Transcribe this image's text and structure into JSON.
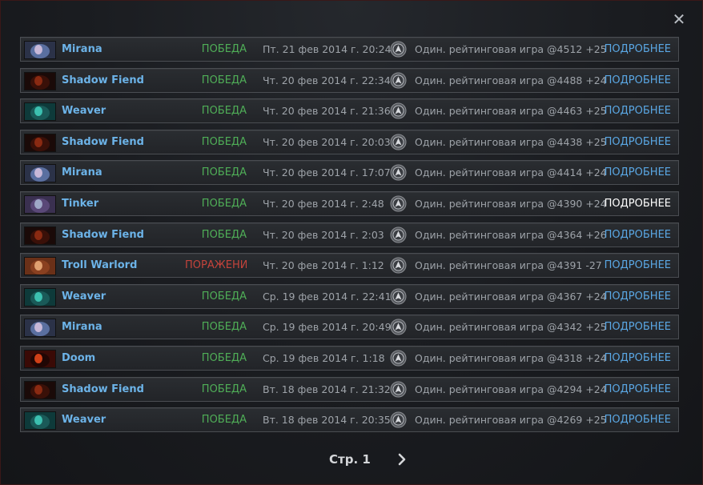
{
  "window": {
    "close_glyph": "✕"
  },
  "matches": [
    {
      "hero": "Mirana",
      "portrait": "mirana",
      "result": "ПОБЕДА",
      "outcome": "win",
      "date": "Пт. 21 фев 2014 г. 20:24",
      "mode": "Один. рейтинговая игра @4512 +25",
      "details": "ПОДРОБНЕЕ"
    },
    {
      "hero": "Shadow Fiend",
      "portrait": "shadow_fiend",
      "result": "ПОБЕДА",
      "outcome": "win",
      "date": "Чт. 20 фев 2014 г. 22:34",
      "mode": "Один. рейтинговая игра @4488 +24",
      "details": "ПОДРОБНЕЕ"
    },
    {
      "hero": "Weaver",
      "portrait": "weaver",
      "result": "ПОБЕДА",
      "outcome": "win",
      "date": "Чт. 20 фев 2014 г. 21:36",
      "mode": "Один. рейтинговая игра @4463 +25",
      "details": "ПОДРОБНЕЕ"
    },
    {
      "hero": "Shadow Fiend",
      "portrait": "shadow_fiend",
      "result": "ПОБЕДА",
      "outcome": "win",
      "date": "Чт. 20 фев 2014 г. 20:03",
      "mode": "Один. рейтинговая игра @4438 +25",
      "details": "ПОДРОБНЕЕ"
    },
    {
      "hero": "Mirana",
      "portrait": "mirana",
      "result": "ПОБЕДА",
      "outcome": "win",
      "date": "Чт. 20 фев 2014 г. 17:07",
      "mode": "Один. рейтинговая игра @4414 +24",
      "details": "ПОДРОБНЕЕ"
    },
    {
      "hero": "Tinker",
      "portrait": "tinker",
      "result": "ПОБЕДА",
      "outcome": "win",
      "date": "Чт. 20 фев 2014 г. 2:48",
      "mode": "Один. рейтинговая игра @4390 +24",
      "details": "ПОДРОБНЕЕ",
      "hovered": true
    },
    {
      "hero": "Shadow Fiend",
      "portrait": "shadow_fiend",
      "result": "ПОБЕДА",
      "outcome": "win",
      "date": "Чт. 20 фев 2014 г. 2:03",
      "mode": "Один. рейтинговая игра @4364 +26",
      "details": "ПОДРОБНЕЕ"
    },
    {
      "hero": "Troll Warlord",
      "portrait": "troll_warlord",
      "result": "ПОРАЖЕНИ",
      "outcome": "loss",
      "date": "Чт. 20 фев 2014 г. 1:12",
      "mode": "Один. рейтинговая игра @4391 -27",
      "details": "ПОДРОБНЕЕ"
    },
    {
      "hero": "Weaver",
      "portrait": "weaver",
      "result": "ПОБЕДА",
      "outcome": "win",
      "date": "Ср. 19 фев 2014 г. 22:41",
      "mode": "Один. рейтинговая игра @4367 +24",
      "details": "ПОДРОБНЕЕ"
    },
    {
      "hero": "Mirana",
      "portrait": "mirana",
      "result": "ПОБЕДА",
      "outcome": "win",
      "date": "Ср. 19 фев 2014 г. 20:49",
      "mode": "Один. рейтинговая игра @4342 +25",
      "details": "ПОДРОБНЕЕ"
    },
    {
      "hero": "Doom",
      "portrait": "doom",
      "result": "ПОБЕДА",
      "outcome": "win",
      "date": "Ср. 19 фев 2014 г. 1:18",
      "mode": "Один. рейтинговая игра @4318 +24",
      "details": "ПОДРОБНЕЕ"
    },
    {
      "hero": "Shadow Fiend",
      "portrait": "shadow_fiend",
      "result": "ПОБЕДА",
      "outcome": "win",
      "date": "Вт. 18 фев 2014 г. 21:32",
      "mode": "Один. рейтинговая игра @4294 +24",
      "details": "ПОДРОБНЕЕ"
    },
    {
      "hero": "Weaver",
      "portrait": "weaver",
      "result": "ПОБЕДА",
      "outcome": "win",
      "date": "Вт. 18 фев 2014 г. 20:35",
      "mode": "Один. рейтинговая игра @4269 +25",
      "details": "ПОДРОБНЕЕ"
    }
  ],
  "pagination": {
    "page_label": "Стр. 1",
    "next_icon": "chevron-right-icon"
  },
  "colors": {
    "win": "#4fae57",
    "loss": "#c4433b",
    "hero_name": "#6cb3e8",
    "details_link": "#5aa7e4"
  },
  "portraits": {
    "mirana": [
      "#2b3248",
      "#c8b8d8",
      "#5a6fa0"
    ],
    "shadow_fiend": [
      "#1a0a08",
      "#8a2a12",
      "#3a1008"
    ],
    "weaver": [
      "#0e3a3a",
      "#3cc0b0",
      "#1a5a58"
    ],
    "tinker": [
      "#3a3050",
      "#9fa8c8",
      "#5a4878"
    ],
    "troll_warlord": [
      "#6a3018",
      "#e0a070",
      "#8a4020"
    ],
    "doom": [
      "#3a0a06",
      "#d04018",
      "#200604"
    ]
  }
}
